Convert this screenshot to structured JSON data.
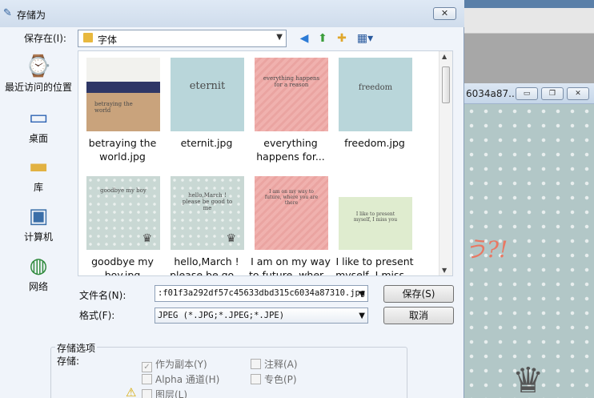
{
  "dialog": {
    "title": "存储为",
    "close_label": "✕",
    "save_in_label": "保存在(I):",
    "save_in_value": "字体",
    "toolbar": [
      "back-icon",
      "up-folder-icon",
      "new-folder-icon",
      "view-menu-icon"
    ]
  },
  "places": [
    {
      "label": "最近访问的位置",
      "icon": "recent-places-icon"
    },
    {
      "label": "桌面",
      "icon": "desktop-icon"
    },
    {
      "label": "库",
      "icon": "libraries-icon"
    },
    {
      "label": "计算机",
      "icon": "computer-icon"
    },
    {
      "label": "网络",
      "icon": "network-icon"
    }
  ],
  "files": [
    {
      "name1": "betraying the",
      "name2": "world.jpg",
      "thumb_text": "betraying the world"
    },
    {
      "name1": "eternit.jpg",
      "name2": "",
      "thumb_text": "eternit"
    },
    {
      "name1": "everything",
      "name2": "happens for...",
      "thumb_text": "everything happens for a reason"
    },
    {
      "name1": "freedom.jpg",
      "name2": "",
      "thumb_text": "freedom"
    },
    {
      "name1": "goodbye my",
      "name2": "boy.jpg",
      "thumb_text": "goodbye my boy"
    },
    {
      "name1": "hello,March !",
      "name2": "please be go...",
      "thumb_text": "hello,March ! please be good to me"
    },
    {
      "name1": "I am on my way",
      "name2": "to future, wher...",
      "thumb_text": "I am on my way to future, where you are there"
    },
    {
      "name1": "I like to present",
      "name2": "myself, I miss...",
      "thumb_text": "I like to present myself, I miss you"
    }
  ],
  "filename": {
    "label": "文件名(N):",
    "value": ":f01f3a292df57c45633dbd315c6034a87310.jpg"
  },
  "format": {
    "label": "格式(F):",
    "value": "JPEG (*.JPG;*.JPEG;*.JPE)"
  },
  "buttons": {
    "save": "保存(S)",
    "cancel": "取消"
  },
  "save_options": {
    "title": "存储选项",
    "sub_label": "存储:",
    "as_copy": "作为副本(Y)",
    "alpha": "Alpha 通道(H)",
    "layers": "图层(L)",
    "notes": "注释(A)",
    "spot": "专色(P)"
  },
  "background_app": {
    "window_title_fragment": "6034a87...",
    "minimize": "▭",
    "restore": "❐",
    "close": "✕",
    "scribble": "う?!"
  }
}
